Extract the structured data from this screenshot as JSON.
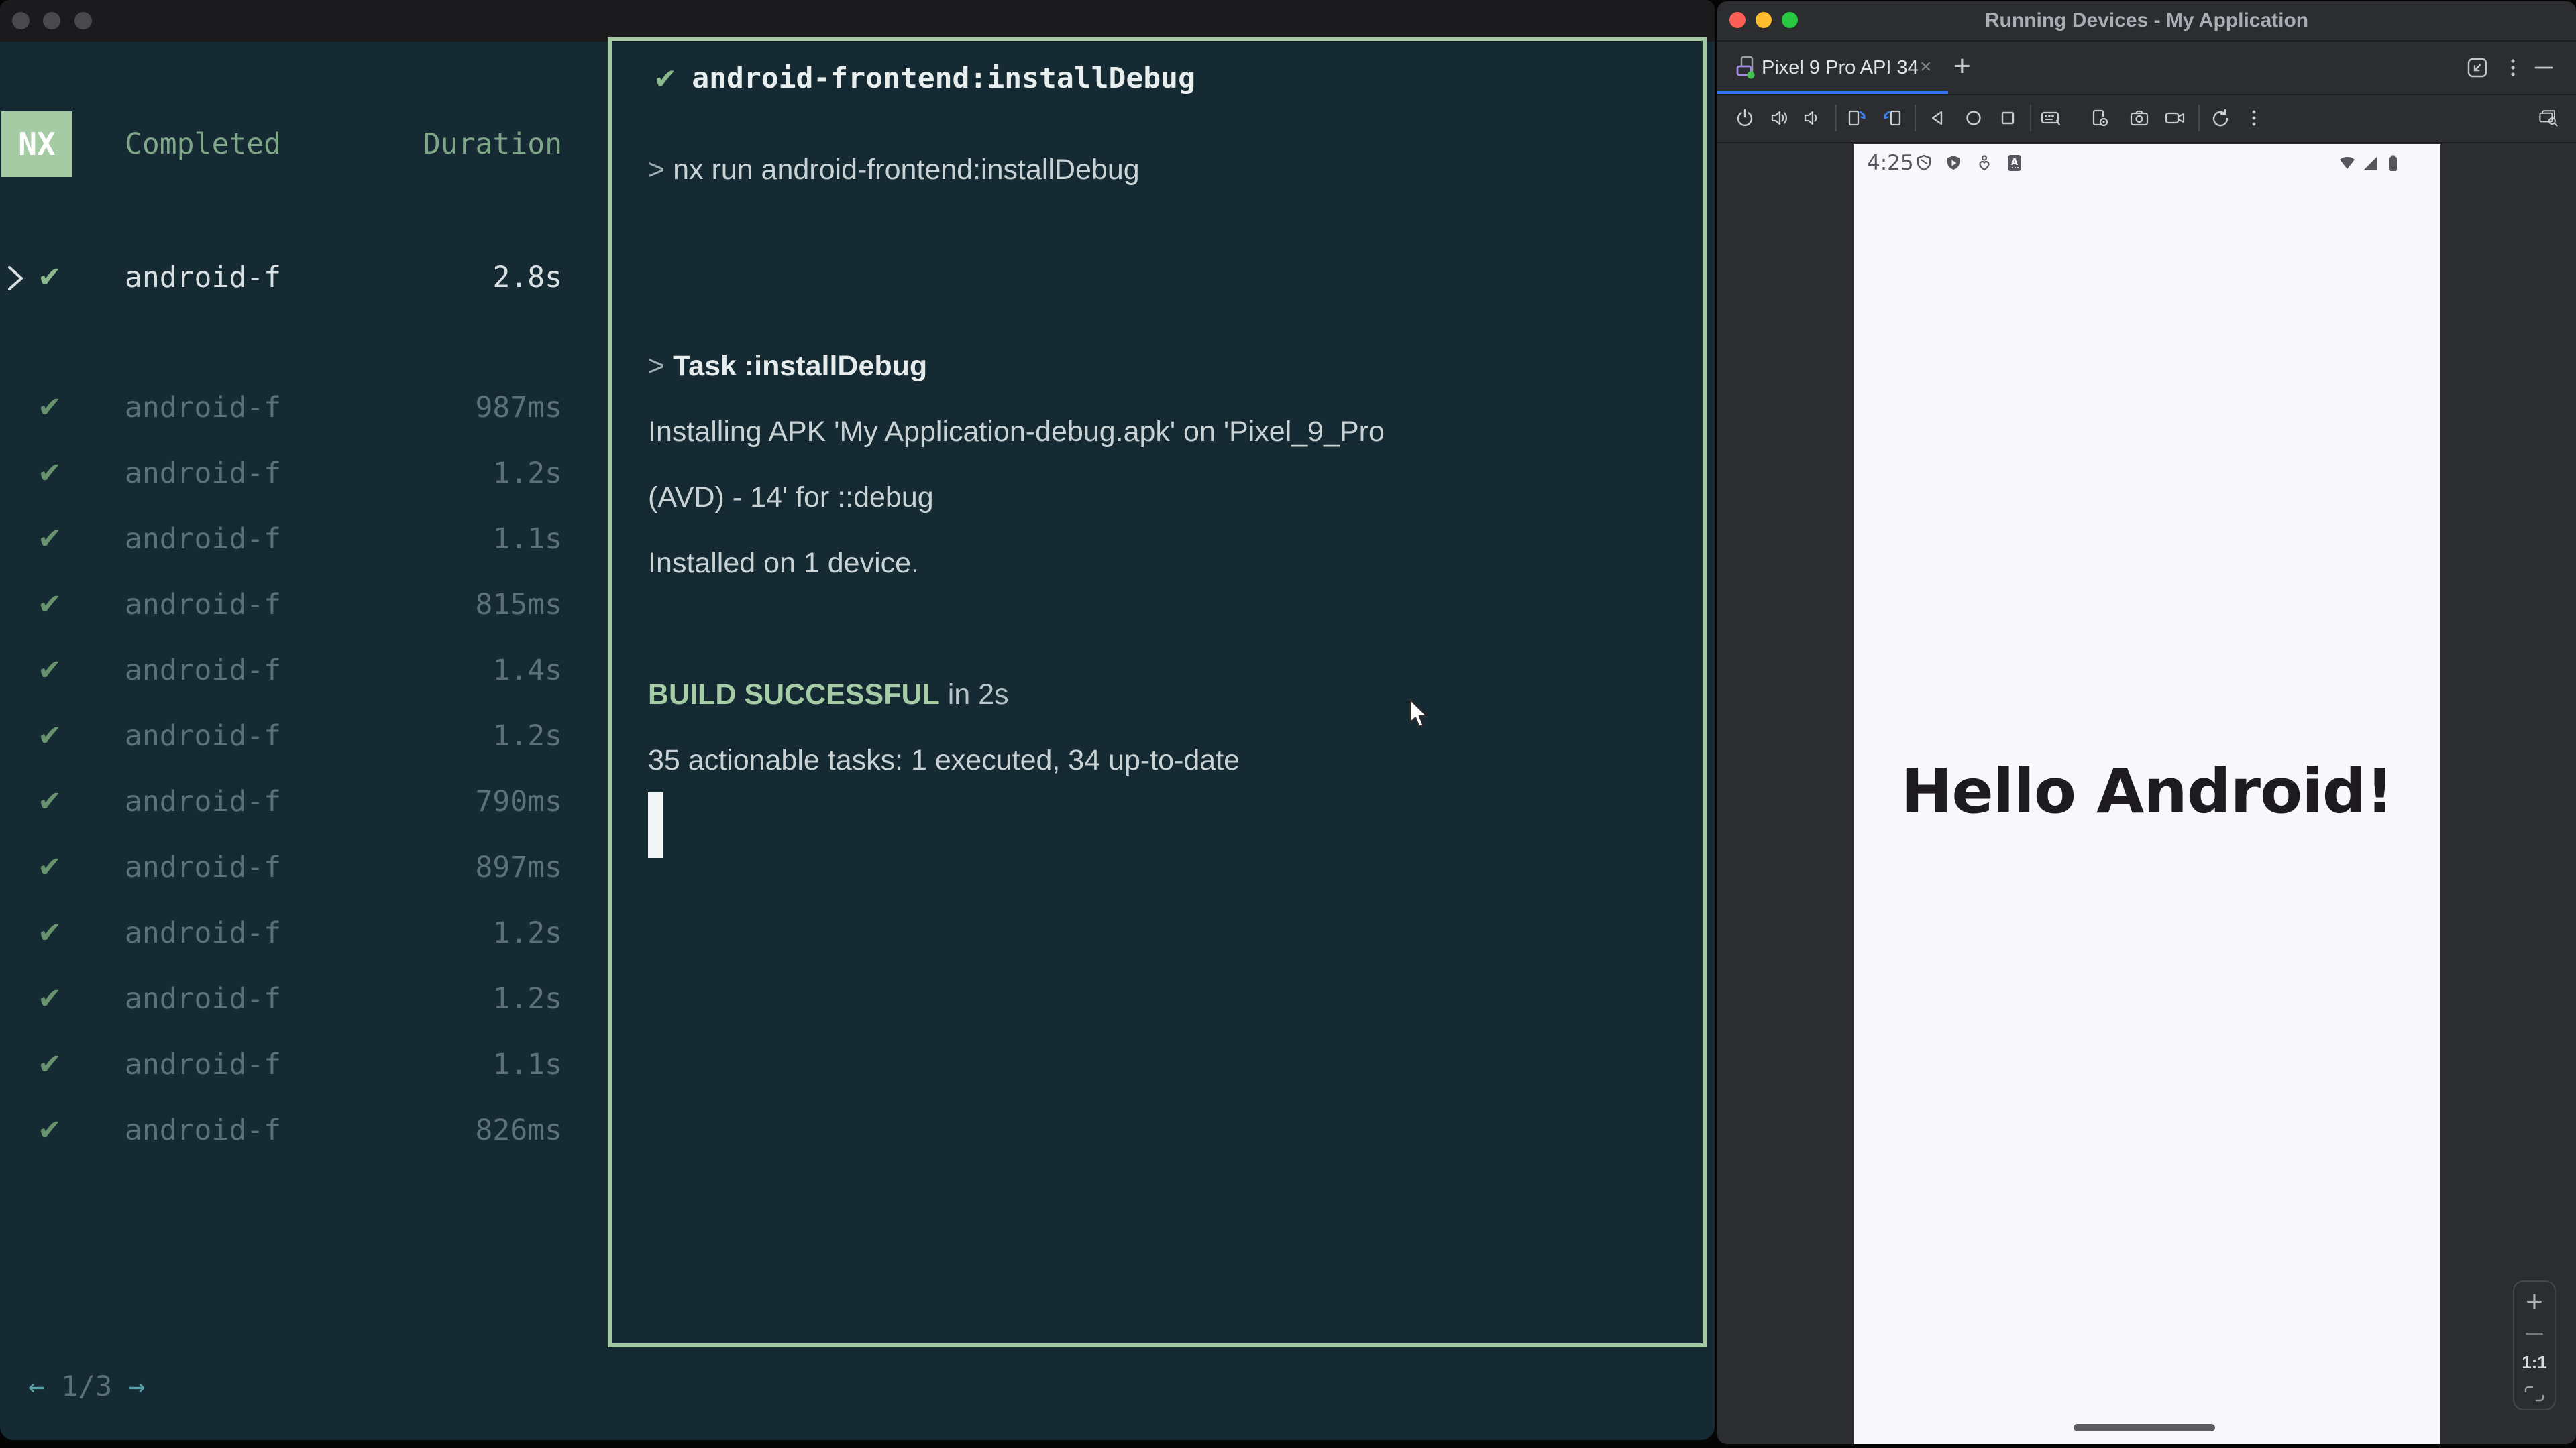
{
  "colors": {
    "terminal_bg": "#152A32",
    "nx_green": "#A5CBA4",
    "border_green": "#A2C9A1",
    "success_green": "#A6CCA5",
    "header_green": "#7EA687",
    "teal_arrow": "#57A1A9",
    "studio_bg": "#2B2D30",
    "tab_accent_blue": "#3574F0",
    "device_bg": "#F8F7FC"
  },
  "terminal": {
    "tasks": {
      "logo": "NX",
      "col_completed": "Completed",
      "col_duration": "Duration",
      "check": "✔",
      "selected": {
        "name": "android-f",
        "duration": "2.8s"
      },
      "rows": [
        {
          "name": "android-f",
          "duration": "987ms"
        },
        {
          "name": "android-f",
          "duration": "1.2s"
        },
        {
          "name": "android-f",
          "duration": "1.1s"
        },
        {
          "name": "android-f",
          "duration": "815ms"
        },
        {
          "name": "android-f",
          "duration": "1.4s"
        },
        {
          "name": "android-f",
          "duration": "1.2s"
        },
        {
          "name": "android-f",
          "duration": "790ms"
        },
        {
          "name": "android-f",
          "duration": "897ms"
        },
        {
          "name": "android-f",
          "duration": "1.2s"
        },
        {
          "name": "android-f",
          "duration": "1.2s"
        },
        {
          "name": "android-f",
          "duration": "1.1s"
        },
        {
          "name": "android-f",
          "duration": "826ms"
        }
      ],
      "pagination": {
        "prev": "←",
        "current": "1/3",
        "next": "→"
      }
    },
    "output": {
      "check": "✔",
      "title": "android-frontend:installDebug",
      "command": {
        "prompt": ">",
        "text": "nx run android-frontend:installDebug"
      },
      "task": {
        "prompt": ">",
        "text": "Task :installDebug"
      },
      "install_line1": "Installing APK 'My Application-debug.apk' on 'Pixel_9_Pro",
      "install_line2": "(AVD) - 14' for ::debug",
      "installed_line": "Installed on 1 device.",
      "build": {
        "status": "BUILD SUCCESSFUL",
        "duration": "in 2s"
      },
      "summary": "35 actionable tasks: 1 executed, 34 up-to-date"
    }
  },
  "studio": {
    "title": "Running Devices - My Application",
    "tab": {
      "label": "Pixel 9 Pro API 34",
      "close": "×",
      "new_tab": "+"
    },
    "device": {
      "time": "4:25",
      "hello": "Hello Android!"
    },
    "zoom_controls": {
      "actual_size": "1:1"
    }
  }
}
